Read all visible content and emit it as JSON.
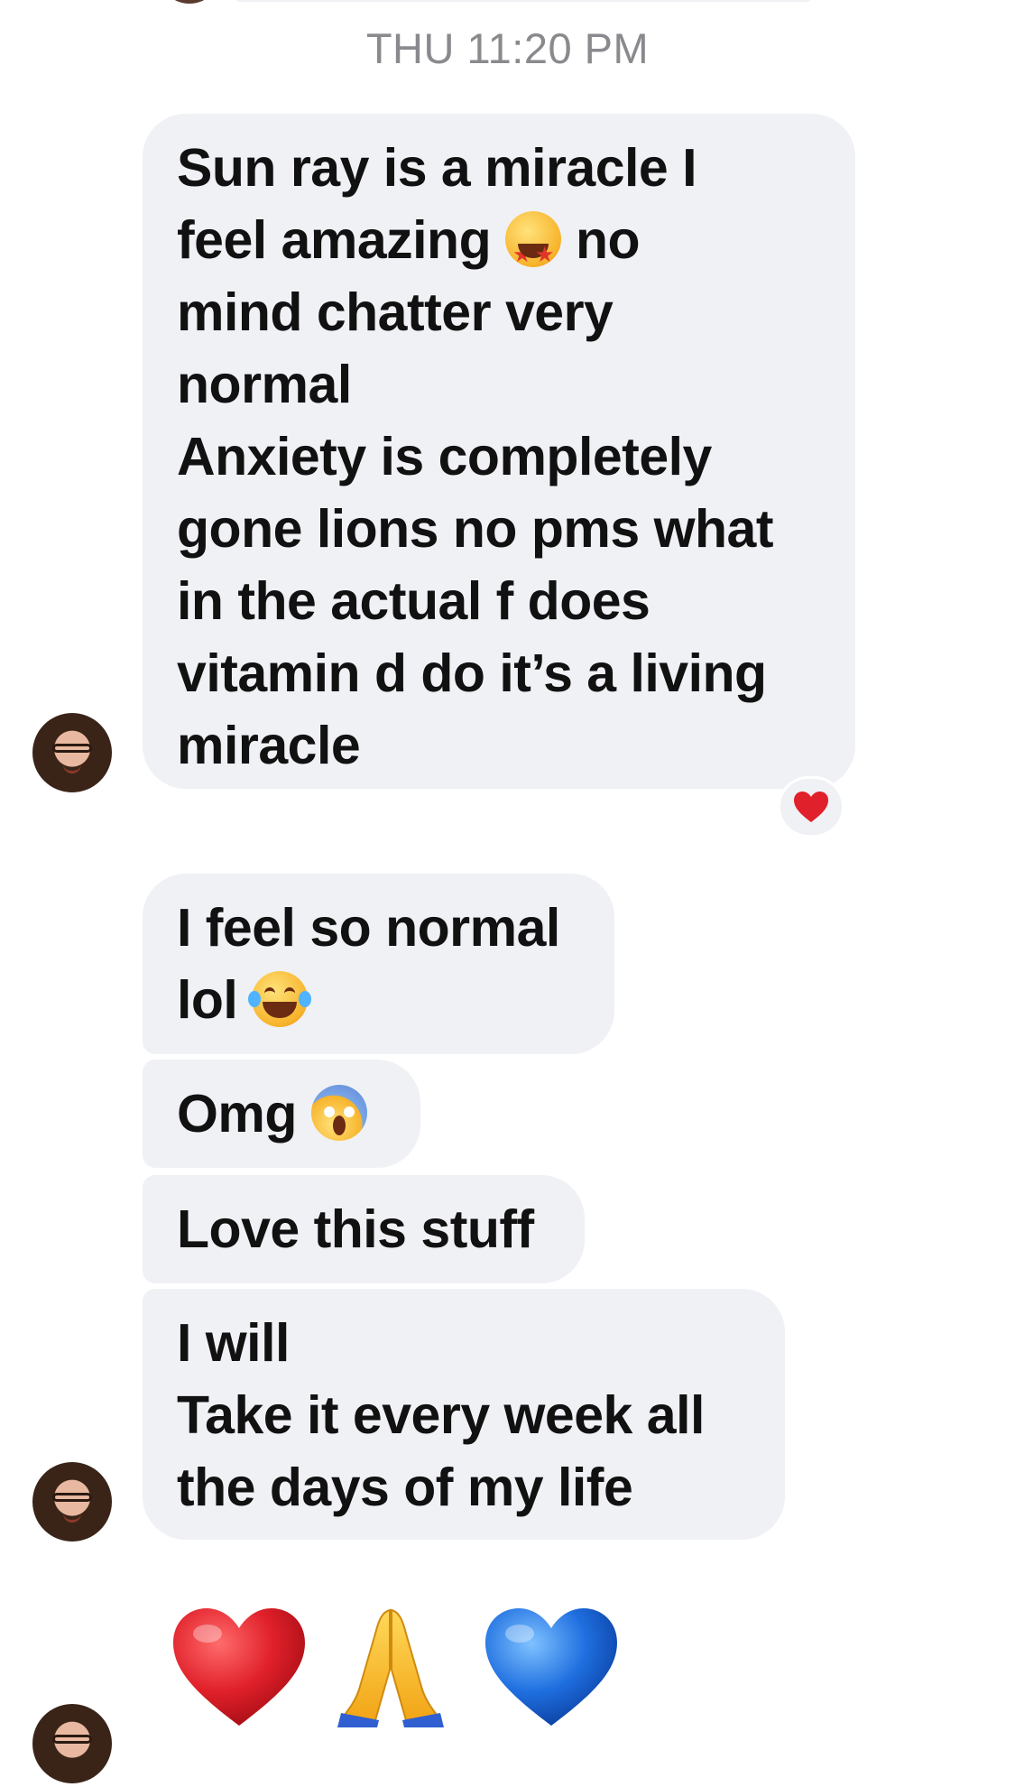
{
  "thread": {
    "timestamp": "THU 11:20 PM",
    "messages": [
      {
        "lines": [
          "Sun ray is a miracle I",
          "feel amazing",
          "no",
          "mind chatter very",
          "normal",
          "Anxiety is completely",
          "gone lions no pms what",
          "in the actual f does",
          "vitamin d do it’s a living",
          "miracle"
        ],
        "emoji": "star-struck-emoji",
        "reaction": "red-heart-reaction"
      },
      {
        "lines": [
          "I feel so normal",
          "lol"
        ],
        "emoji": "tears-of-joy-emoji"
      },
      {
        "lines": [
          "Omg"
        ],
        "emoji": "screaming-face-emoji"
      },
      {
        "lines": [
          "Love this stuff"
        ]
      },
      {
        "lines": [
          "I will",
          "Take it every week all",
          "the days of my life"
        ]
      }
    ],
    "large_emoji_message": [
      "red-heart-emoji",
      "folded-hands-emoji",
      "blue-heart-emoji"
    ]
  },
  "colors": {
    "bubble_background": "#f0f1f5",
    "timestamp_text": "#8a8a8e",
    "message_text": "#111111",
    "heart_red": "#e0202a",
    "heart_blue": "#1f6fe0"
  }
}
